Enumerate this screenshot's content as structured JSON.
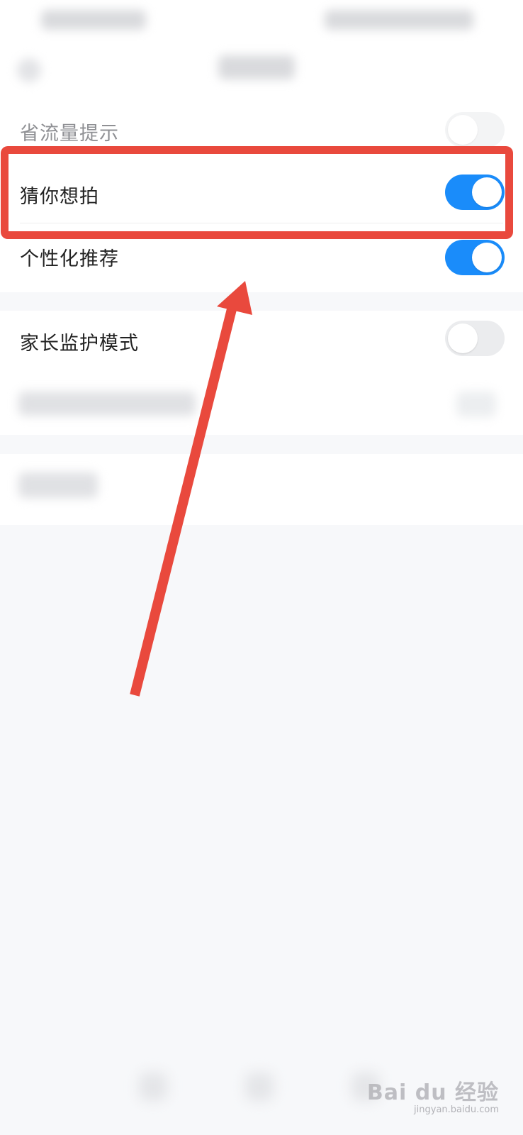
{
  "settings": {
    "items": [
      {
        "label": "省流量提示",
        "toggle_on": false
      },
      {
        "label": "猜你想拍",
        "toggle_on": true
      },
      {
        "label": "个性化推荐",
        "toggle_on": true
      },
      {
        "label": "家长监护模式",
        "toggle_on": false
      }
    ]
  },
  "annotation": {
    "highlight_target": "猜你想拍",
    "color": "#e9493d"
  },
  "colors": {
    "toggle_on": "#1a8cfa",
    "toggle_off": "#ebecee",
    "background": "#f7f8fa"
  },
  "watermark": {
    "logo": "Bai du 经验",
    "url": "jingyan.baidu.com"
  }
}
